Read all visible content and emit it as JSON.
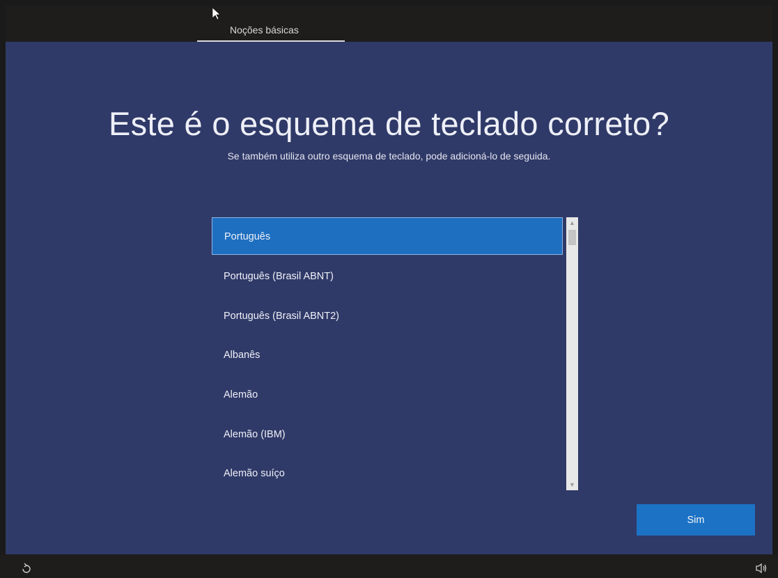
{
  "header": {
    "tab_label": "Noções básicas"
  },
  "main": {
    "title": "Este é o esquema de teclado correto?",
    "subtitle": "Se também utiliza outro esquema de teclado, pode adicioná-lo de seguida.",
    "layouts": [
      "Português",
      "Português (Brasil ABNT)",
      "Português (Brasil ABNT2)",
      "Albanês",
      "Alemão",
      "Alemão (IBM)",
      "Alemão suíço"
    ],
    "selected_layout": "Português",
    "confirm_label": "Sim"
  },
  "footer": {
    "left_icon": "ease-of-access-icon",
    "right_icon": "volume-icon"
  },
  "colors": {
    "background": "#303a68",
    "accent": "#1c72c4",
    "bar": "#1e1d1c"
  }
}
